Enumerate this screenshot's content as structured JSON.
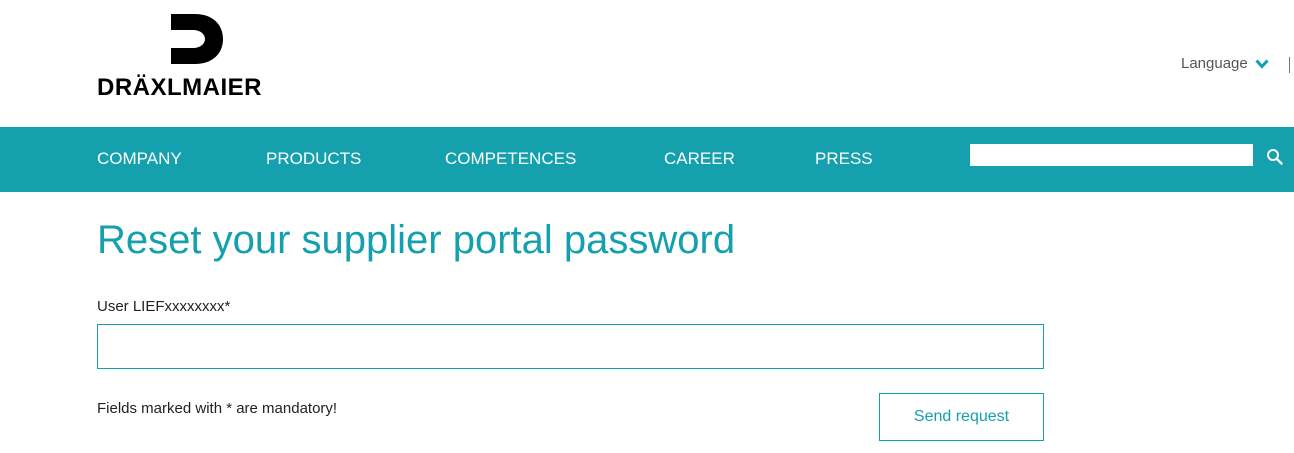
{
  "header": {
    "logo_text": "DRÄXLMAIER",
    "language_label": "Language"
  },
  "nav": {
    "items": [
      {
        "label": "COMPANY"
      },
      {
        "label": "PRODUCTS"
      },
      {
        "label": "COMPETENCES"
      },
      {
        "label": "CAREER"
      },
      {
        "label": "PRESS"
      }
    ],
    "search": {
      "value": "",
      "placeholder": ""
    }
  },
  "main": {
    "title": "Reset your supplier portal password",
    "user_label": "User LIEFxxxxxxxx*",
    "user_value": "",
    "mandatory_note": "Fields marked with * are mandatory!",
    "send_button_label": "Send request"
  },
  "colors": {
    "brand": "#15a0ae",
    "text": "#222222",
    "logo": "#000000"
  },
  "icons": {
    "logo": "draexlmaier-d-logo-icon",
    "language": "chevron-down-icon",
    "search": "search-icon"
  }
}
